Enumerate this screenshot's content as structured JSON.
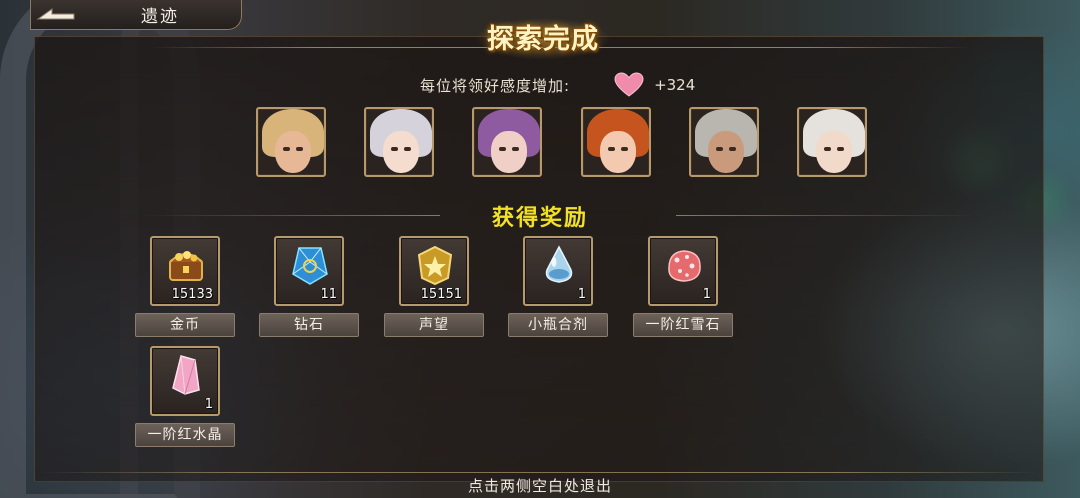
{
  "header": {
    "title": "遗迹"
  },
  "banner": {
    "title": "探索完成"
  },
  "affection": {
    "label": "每位将领好感度增加:",
    "value": "+324",
    "icon": "heart-icon",
    "color": "#f08bab"
  },
  "portraits": [
    {
      "name": "portrait-1",
      "hair": "#d8b37a",
      "skin": "#e6b895"
    },
    {
      "name": "portrait-2",
      "hair": "#d5d2dc",
      "skin": "#f4dccf"
    },
    {
      "name": "portrait-3",
      "hair": "#8e5aa0",
      "skin": "#f0cfc7"
    },
    {
      "name": "portrait-4",
      "hair": "#c5541e",
      "skin": "#f3c9b0"
    },
    {
      "name": "portrait-5",
      "hair": "#b9b6b0",
      "skin": "#c99b7c"
    },
    {
      "name": "portrait-6",
      "hair": "#e5e1dc",
      "skin": "#f2dacb"
    }
  ],
  "rewards_heading": "获得奖励",
  "rewards": [
    {
      "name": "金币",
      "qty": "15133",
      "icon": "treasure-chest-icon"
    },
    {
      "name": "钻石",
      "qty": "11",
      "icon": "diamond-crystal-icon"
    },
    {
      "name": "声望",
      "qty": "15151",
      "icon": "prestige-badge-icon"
    },
    {
      "name": "小瓶合剂",
      "qty": "1",
      "icon": "potion-drop-icon"
    },
    {
      "name": "一阶红雪石",
      "qty": "1",
      "icon": "red-snow-stone-icon"
    },
    {
      "name": "一阶红水晶",
      "qty": "1",
      "icon": "red-crystal-icon"
    }
  ],
  "footer": {
    "hint": "点击两侧空白处退出"
  }
}
